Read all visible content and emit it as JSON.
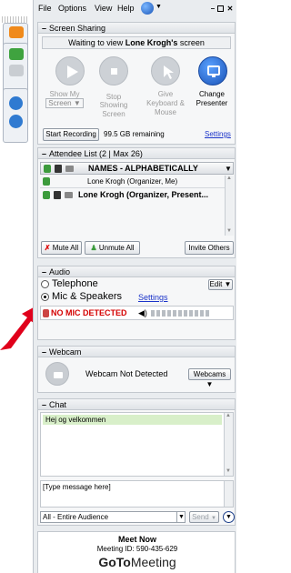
{
  "menu": [
    "File",
    "Options",
    "View",
    "Help"
  ],
  "screen_sharing": {
    "header": "Screen Sharing",
    "status_prefix": "Waiting to view ",
    "status_name": "Lone Krogh's",
    "status_suffix": " screen",
    "buttons": [
      {
        "label": "Show My",
        "sub": "Screen ▼"
      },
      {
        "label": "Stop",
        "sub": "Showing Screen"
      },
      {
        "label": "Give",
        "sub": "Keyboard & Mouse"
      },
      {
        "label": "Change",
        "sub": "Presenter"
      }
    ],
    "start_recording": "Start Recording",
    "remaining": "99.5 GB remaining",
    "settings": "Settings"
  },
  "attendees": {
    "header": "Attendee List  (2 | Max 26)",
    "sort_label": "NAMES - ALPHABETICALLY",
    "rows": [
      {
        "name": "Lone Krogh (Organizer, Me)"
      },
      {
        "name": "Lone Krogh (Organizer, Present..."
      }
    ],
    "mute_all": "Mute All",
    "unmute_all": "Unmute All",
    "invite": "Invite Others"
  },
  "audio": {
    "header": "Audio",
    "telephone": "Telephone",
    "edit": "Edit ▼",
    "mic_speakers": "Mic & Speakers",
    "settings": "Settings",
    "no_mic": "NO MIC DETECTED"
  },
  "webcam": {
    "header": "Webcam",
    "status": "Webcam Not Detected",
    "button": "Webcams ▼"
  },
  "chat": {
    "header": "Chat",
    "messages": [
      "Hej og velkommen"
    ],
    "input_placeholder": "[Type message here]",
    "recipient": "All - Entire Audience",
    "send": "Send"
  },
  "footer": {
    "title": "Meet Now",
    "meeting_id": "Meeting ID: 590-435-629",
    "brand_bold": "GoTo",
    "brand_light": "Meeting"
  },
  "colors": {
    "accent_blue": "#1a33c9",
    "no_mic_red": "#d40000",
    "arrow_red": "#e0001b",
    "chat_msg_bg": "#d8efc9"
  }
}
